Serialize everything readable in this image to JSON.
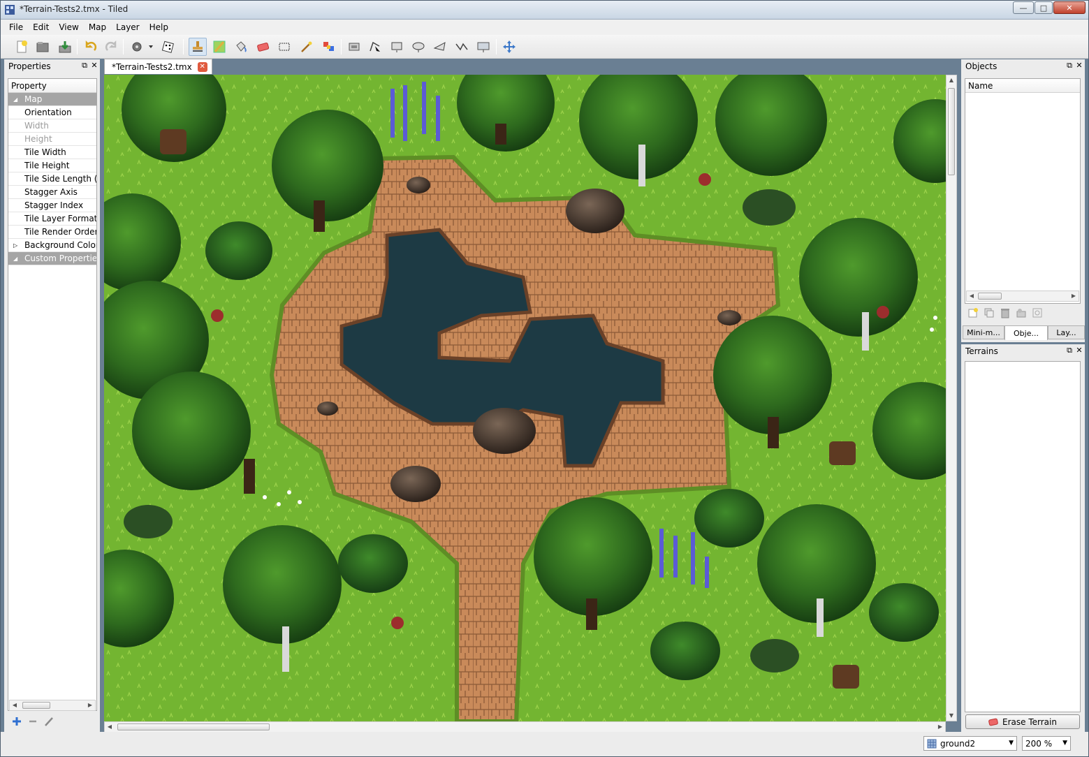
{
  "window": {
    "title": "*Terrain-Tests2.tmx - Tiled",
    "minimize": "—",
    "maximize": "□",
    "close": "✕"
  },
  "menu": [
    "File",
    "Edit",
    "View",
    "Map",
    "Layer",
    "Help"
  ],
  "toolbar": {
    "icons": [
      "new-file-icon",
      "open-file-icon",
      "save-file-icon",
      "undo-icon",
      "redo-icon",
      "command-icon",
      "random-mode-icon",
      "stamp-brush-icon",
      "terrain-brush-icon",
      "bucket-fill-icon",
      "eraser-icon",
      "rectangular-select-icon",
      "magic-wand-icon",
      "select-same-tile-icon",
      "insert-tile-icon",
      "edit-polygons-icon",
      "insert-rectangle-icon",
      "insert-ellipse-icon",
      "insert-polygon-icon",
      "insert-polyline-icon",
      "insert-tile-object-icon",
      "move-objects-icon"
    ]
  },
  "properties_panel": {
    "title": "Properties",
    "column_header": "Property",
    "rows": [
      {
        "label": "Map",
        "kind": "group",
        "arrow": "◢"
      },
      {
        "label": "Orientation",
        "kind": "normal"
      },
      {
        "label": "Width",
        "kind": "disabled"
      },
      {
        "label": "Height",
        "kind": "disabled"
      },
      {
        "label": "Tile Width",
        "kind": "normal"
      },
      {
        "label": "Tile Height",
        "kind": "normal"
      },
      {
        "label": "Tile Side Length (Hex)",
        "kind": "normal"
      },
      {
        "label": "Stagger Axis",
        "kind": "normal"
      },
      {
        "label": "Stagger Index",
        "kind": "normal"
      },
      {
        "label": "Tile Layer Format",
        "kind": "normal"
      },
      {
        "label": "Tile Render Order",
        "kind": "normal"
      },
      {
        "label": "Background Color",
        "kind": "normal",
        "arrow": "▷"
      },
      {
        "label": "Custom Properties",
        "kind": "group",
        "arrow": "◢"
      }
    ],
    "footer_icons": [
      "add-property-icon",
      "remove-property-icon",
      "rename-property-icon"
    ]
  },
  "document_tab": {
    "label": "*Terrain-Tests2.tmx",
    "close": "✕"
  },
  "objects_panel": {
    "title": "Objects",
    "column_header": "Name",
    "tool_icons": [
      "new-object-layer-icon",
      "duplicate-objects-icon",
      "delete-objects-icon",
      "move-objects-to-layer-icon",
      "object-properties-icon"
    ],
    "tabs": [
      {
        "label": "Mini-m...",
        "active": false
      },
      {
        "label": "Obje...",
        "active": true
      },
      {
        "label": "Lay...",
        "active": false
      }
    ]
  },
  "terrains_panel": {
    "title": "Terrains",
    "erase_button": "Erase Terrain"
  },
  "statusbar": {
    "layer_combo": "ground2",
    "zoom_combo": "200 %"
  },
  "colors": {
    "panel_bg": "#ececec",
    "group_row": "#a5a5a5",
    "grass": "#6fb32e",
    "path": "#c98a5a",
    "water": "#1d3a44"
  }
}
